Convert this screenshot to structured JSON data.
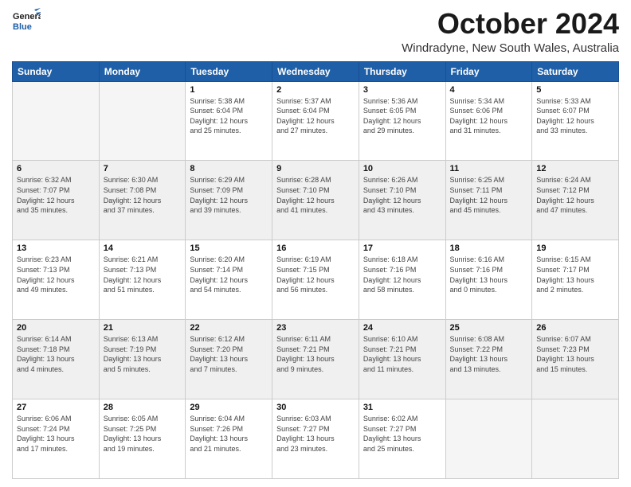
{
  "logo": {
    "line1": "General",
    "line2": "Blue"
  },
  "header": {
    "month": "October 2024",
    "location": "Windradyne, New South Wales, Australia"
  },
  "days_of_week": [
    "Sunday",
    "Monday",
    "Tuesday",
    "Wednesday",
    "Thursday",
    "Friday",
    "Saturday"
  ],
  "weeks": [
    [
      {
        "day": "",
        "info": ""
      },
      {
        "day": "",
        "info": ""
      },
      {
        "day": "1",
        "info": "Sunrise: 5:38 AM\nSunset: 6:04 PM\nDaylight: 12 hours\nand 25 minutes."
      },
      {
        "day": "2",
        "info": "Sunrise: 5:37 AM\nSunset: 6:04 PM\nDaylight: 12 hours\nand 27 minutes."
      },
      {
        "day": "3",
        "info": "Sunrise: 5:36 AM\nSunset: 6:05 PM\nDaylight: 12 hours\nand 29 minutes."
      },
      {
        "day": "4",
        "info": "Sunrise: 5:34 AM\nSunset: 6:06 PM\nDaylight: 12 hours\nand 31 minutes."
      },
      {
        "day": "5",
        "info": "Sunrise: 5:33 AM\nSunset: 6:07 PM\nDaylight: 12 hours\nand 33 minutes."
      }
    ],
    [
      {
        "day": "6",
        "info": "Sunrise: 6:32 AM\nSunset: 7:07 PM\nDaylight: 12 hours\nand 35 minutes."
      },
      {
        "day": "7",
        "info": "Sunrise: 6:30 AM\nSunset: 7:08 PM\nDaylight: 12 hours\nand 37 minutes."
      },
      {
        "day": "8",
        "info": "Sunrise: 6:29 AM\nSunset: 7:09 PM\nDaylight: 12 hours\nand 39 minutes."
      },
      {
        "day": "9",
        "info": "Sunrise: 6:28 AM\nSunset: 7:10 PM\nDaylight: 12 hours\nand 41 minutes."
      },
      {
        "day": "10",
        "info": "Sunrise: 6:26 AM\nSunset: 7:10 PM\nDaylight: 12 hours\nand 43 minutes."
      },
      {
        "day": "11",
        "info": "Sunrise: 6:25 AM\nSunset: 7:11 PM\nDaylight: 12 hours\nand 45 minutes."
      },
      {
        "day": "12",
        "info": "Sunrise: 6:24 AM\nSunset: 7:12 PM\nDaylight: 12 hours\nand 47 minutes."
      }
    ],
    [
      {
        "day": "13",
        "info": "Sunrise: 6:23 AM\nSunset: 7:13 PM\nDaylight: 12 hours\nand 49 minutes."
      },
      {
        "day": "14",
        "info": "Sunrise: 6:21 AM\nSunset: 7:13 PM\nDaylight: 12 hours\nand 51 minutes."
      },
      {
        "day": "15",
        "info": "Sunrise: 6:20 AM\nSunset: 7:14 PM\nDaylight: 12 hours\nand 54 minutes."
      },
      {
        "day": "16",
        "info": "Sunrise: 6:19 AM\nSunset: 7:15 PM\nDaylight: 12 hours\nand 56 minutes."
      },
      {
        "day": "17",
        "info": "Sunrise: 6:18 AM\nSunset: 7:16 PM\nDaylight: 12 hours\nand 58 minutes."
      },
      {
        "day": "18",
        "info": "Sunrise: 6:16 AM\nSunset: 7:16 PM\nDaylight: 13 hours\nand 0 minutes."
      },
      {
        "day": "19",
        "info": "Sunrise: 6:15 AM\nSunset: 7:17 PM\nDaylight: 13 hours\nand 2 minutes."
      }
    ],
    [
      {
        "day": "20",
        "info": "Sunrise: 6:14 AM\nSunset: 7:18 PM\nDaylight: 13 hours\nand 4 minutes."
      },
      {
        "day": "21",
        "info": "Sunrise: 6:13 AM\nSunset: 7:19 PM\nDaylight: 13 hours\nand 5 minutes."
      },
      {
        "day": "22",
        "info": "Sunrise: 6:12 AM\nSunset: 7:20 PM\nDaylight: 13 hours\nand 7 minutes."
      },
      {
        "day": "23",
        "info": "Sunrise: 6:11 AM\nSunset: 7:21 PM\nDaylight: 13 hours\nand 9 minutes."
      },
      {
        "day": "24",
        "info": "Sunrise: 6:10 AM\nSunset: 7:21 PM\nDaylight: 13 hours\nand 11 minutes."
      },
      {
        "day": "25",
        "info": "Sunrise: 6:08 AM\nSunset: 7:22 PM\nDaylight: 13 hours\nand 13 minutes."
      },
      {
        "day": "26",
        "info": "Sunrise: 6:07 AM\nSunset: 7:23 PM\nDaylight: 13 hours\nand 15 minutes."
      }
    ],
    [
      {
        "day": "27",
        "info": "Sunrise: 6:06 AM\nSunset: 7:24 PM\nDaylight: 13 hours\nand 17 minutes."
      },
      {
        "day": "28",
        "info": "Sunrise: 6:05 AM\nSunset: 7:25 PM\nDaylight: 13 hours\nand 19 minutes."
      },
      {
        "day": "29",
        "info": "Sunrise: 6:04 AM\nSunset: 7:26 PM\nDaylight: 13 hours\nand 21 minutes."
      },
      {
        "day": "30",
        "info": "Sunrise: 6:03 AM\nSunset: 7:27 PM\nDaylight: 13 hours\nand 23 minutes."
      },
      {
        "day": "31",
        "info": "Sunrise: 6:02 AM\nSunset: 7:27 PM\nDaylight: 13 hours\nand 25 minutes."
      },
      {
        "day": "",
        "info": ""
      },
      {
        "day": "",
        "info": ""
      }
    ]
  ]
}
